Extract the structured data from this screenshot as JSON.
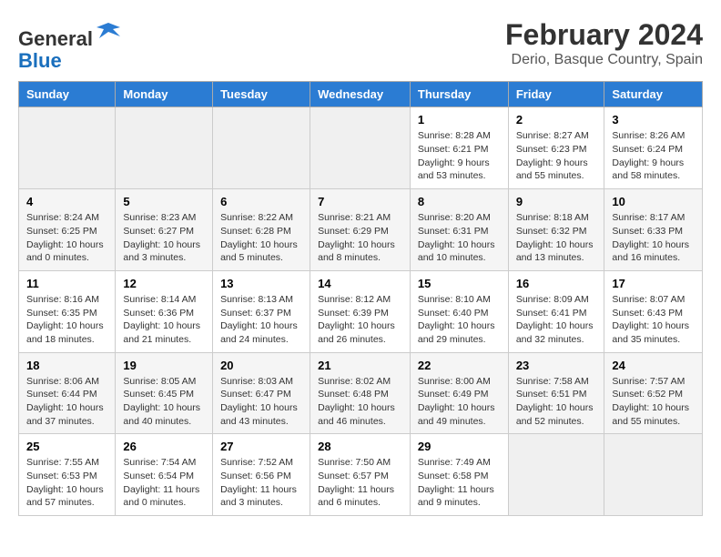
{
  "header": {
    "logo_line1": "General",
    "logo_line2": "Blue",
    "title": "February 2024",
    "subtitle": "Derio, Basque Country, Spain"
  },
  "days_of_week": [
    "Sunday",
    "Monday",
    "Tuesday",
    "Wednesday",
    "Thursday",
    "Friday",
    "Saturday"
  ],
  "weeks": [
    {
      "days": [
        {
          "num": "",
          "info": ""
        },
        {
          "num": "",
          "info": ""
        },
        {
          "num": "",
          "info": ""
        },
        {
          "num": "",
          "info": ""
        },
        {
          "num": "1",
          "info": "Sunrise: 8:28 AM\nSunset: 6:21 PM\nDaylight: 9 hours and 53 minutes."
        },
        {
          "num": "2",
          "info": "Sunrise: 8:27 AM\nSunset: 6:23 PM\nDaylight: 9 hours and 55 minutes."
        },
        {
          "num": "3",
          "info": "Sunrise: 8:26 AM\nSunset: 6:24 PM\nDaylight: 9 hours and 58 minutes."
        }
      ]
    },
    {
      "days": [
        {
          "num": "4",
          "info": "Sunrise: 8:24 AM\nSunset: 6:25 PM\nDaylight: 10 hours and 0 minutes."
        },
        {
          "num": "5",
          "info": "Sunrise: 8:23 AM\nSunset: 6:27 PM\nDaylight: 10 hours and 3 minutes."
        },
        {
          "num": "6",
          "info": "Sunrise: 8:22 AM\nSunset: 6:28 PM\nDaylight: 10 hours and 5 minutes."
        },
        {
          "num": "7",
          "info": "Sunrise: 8:21 AM\nSunset: 6:29 PM\nDaylight: 10 hours and 8 minutes."
        },
        {
          "num": "8",
          "info": "Sunrise: 8:20 AM\nSunset: 6:31 PM\nDaylight: 10 hours and 10 minutes."
        },
        {
          "num": "9",
          "info": "Sunrise: 8:18 AM\nSunset: 6:32 PM\nDaylight: 10 hours and 13 minutes."
        },
        {
          "num": "10",
          "info": "Sunrise: 8:17 AM\nSunset: 6:33 PM\nDaylight: 10 hours and 16 minutes."
        }
      ]
    },
    {
      "days": [
        {
          "num": "11",
          "info": "Sunrise: 8:16 AM\nSunset: 6:35 PM\nDaylight: 10 hours and 18 minutes."
        },
        {
          "num": "12",
          "info": "Sunrise: 8:14 AM\nSunset: 6:36 PM\nDaylight: 10 hours and 21 minutes."
        },
        {
          "num": "13",
          "info": "Sunrise: 8:13 AM\nSunset: 6:37 PM\nDaylight: 10 hours and 24 minutes."
        },
        {
          "num": "14",
          "info": "Sunrise: 8:12 AM\nSunset: 6:39 PM\nDaylight: 10 hours and 26 minutes."
        },
        {
          "num": "15",
          "info": "Sunrise: 8:10 AM\nSunset: 6:40 PM\nDaylight: 10 hours and 29 minutes."
        },
        {
          "num": "16",
          "info": "Sunrise: 8:09 AM\nSunset: 6:41 PM\nDaylight: 10 hours and 32 minutes."
        },
        {
          "num": "17",
          "info": "Sunrise: 8:07 AM\nSunset: 6:43 PM\nDaylight: 10 hours and 35 minutes."
        }
      ]
    },
    {
      "days": [
        {
          "num": "18",
          "info": "Sunrise: 8:06 AM\nSunset: 6:44 PM\nDaylight: 10 hours and 37 minutes."
        },
        {
          "num": "19",
          "info": "Sunrise: 8:05 AM\nSunset: 6:45 PM\nDaylight: 10 hours and 40 minutes."
        },
        {
          "num": "20",
          "info": "Sunrise: 8:03 AM\nSunset: 6:47 PM\nDaylight: 10 hours and 43 minutes."
        },
        {
          "num": "21",
          "info": "Sunrise: 8:02 AM\nSunset: 6:48 PM\nDaylight: 10 hours and 46 minutes."
        },
        {
          "num": "22",
          "info": "Sunrise: 8:00 AM\nSunset: 6:49 PM\nDaylight: 10 hours and 49 minutes."
        },
        {
          "num": "23",
          "info": "Sunrise: 7:58 AM\nSunset: 6:51 PM\nDaylight: 10 hours and 52 minutes."
        },
        {
          "num": "24",
          "info": "Sunrise: 7:57 AM\nSunset: 6:52 PM\nDaylight: 10 hours and 55 minutes."
        }
      ]
    },
    {
      "days": [
        {
          "num": "25",
          "info": "Sunrise: 7:55 AM\nSunset: 6:53 PM\nDaylight: 10 hours and 57 minutes."
        },
        {
          "num": "26",
          "info": "Sunrise: 7:54 AM\nSunset: 6:54 PM\nDaylight: 11 hours and 0 minutes."
        },
        {
          "num": "27",
          "info": "Sunrise: 7:52 AM\nSunset: 6:56 PM\nDaylight: 11 hours and 3 minutes."
        },
        {
          "num": "28",
          "info": "Sunrise: 7:50 AM\nSunset: 6:57 PM\nDaylight: 11 hours and 6 minutes."
        },
        {
          "num": "29",
          "info": "Sunrise: 7:49 AM\nSunset: 6:58 PM\nDaylight: 11 hours and 9 minutes."
        },
        {
          "num": "",
          "info": ""
        },
        {
          "num": "",
          "info": ""
        }
      ]
    }
  ]
}
